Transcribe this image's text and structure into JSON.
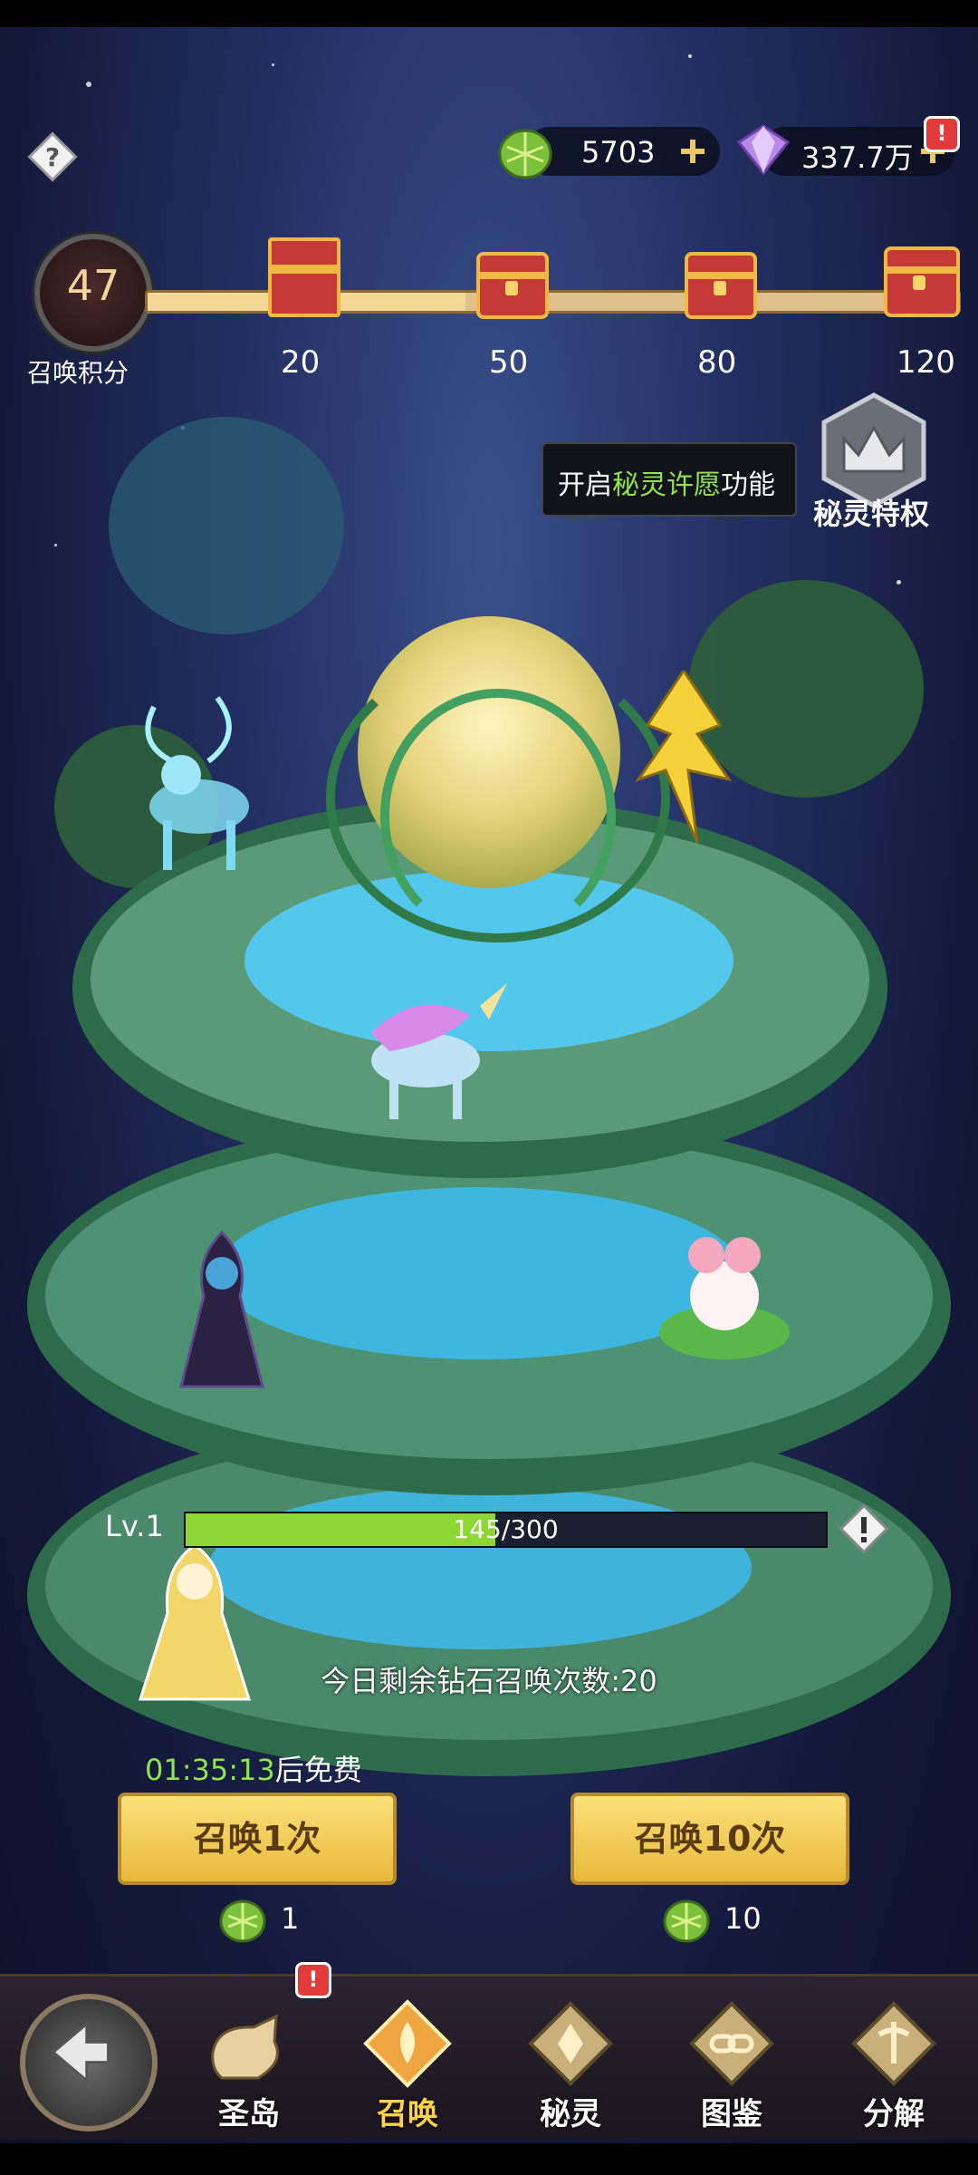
{
  "currencies": {
    "leaf": {
      "value": "5703"
    },
    "diamond": {
      "value": "337.7万"
    }
  },
  "alerts": {
    "diamond_badge": "!",
    "island_badge": "!"
  },
  "summon_score": {
    "value": "47",
    "label": "召唤积分",
    "milestones": [
      "20",
      "50",
      "80",
      "120"
    ],
    "progress": 47,
    "max": 120
  },
  "tooltip": {
    "prefix": "开启",
    "highlight": "秘灵许愿",
    "suffix": "功能"
  },
  "privilege": {
    "label": "秘灵特权"
  },
  "level": {
    "label": "Lv.1",
    "current": "145",
    "separator": "/300",
    "value": 145,
    "max": 300
  },
  "remaining": "今日剩余钻石召唤次数:20",
  "free_timer": {
    "time": "01:35:13",
    "suffix": "后免费"
  },
  "buttons": {
    "summon1": "召唤1次",
    "summon10": "召唤10次"
  },
  "costs": {
    "summon1": "1",
    "summon10": "10"
  },
  "nav": {
    "island": "圣岛",
    "summon": "召唤",
    "spirit": "秘灵",
    "codex": "图鉴",
    "decompose": "分解"
  },
  "colors": {
    "accent": "#8fe64b",
    "button": "#f2cf58",
    "chest": "#c63a38"
  }
}
